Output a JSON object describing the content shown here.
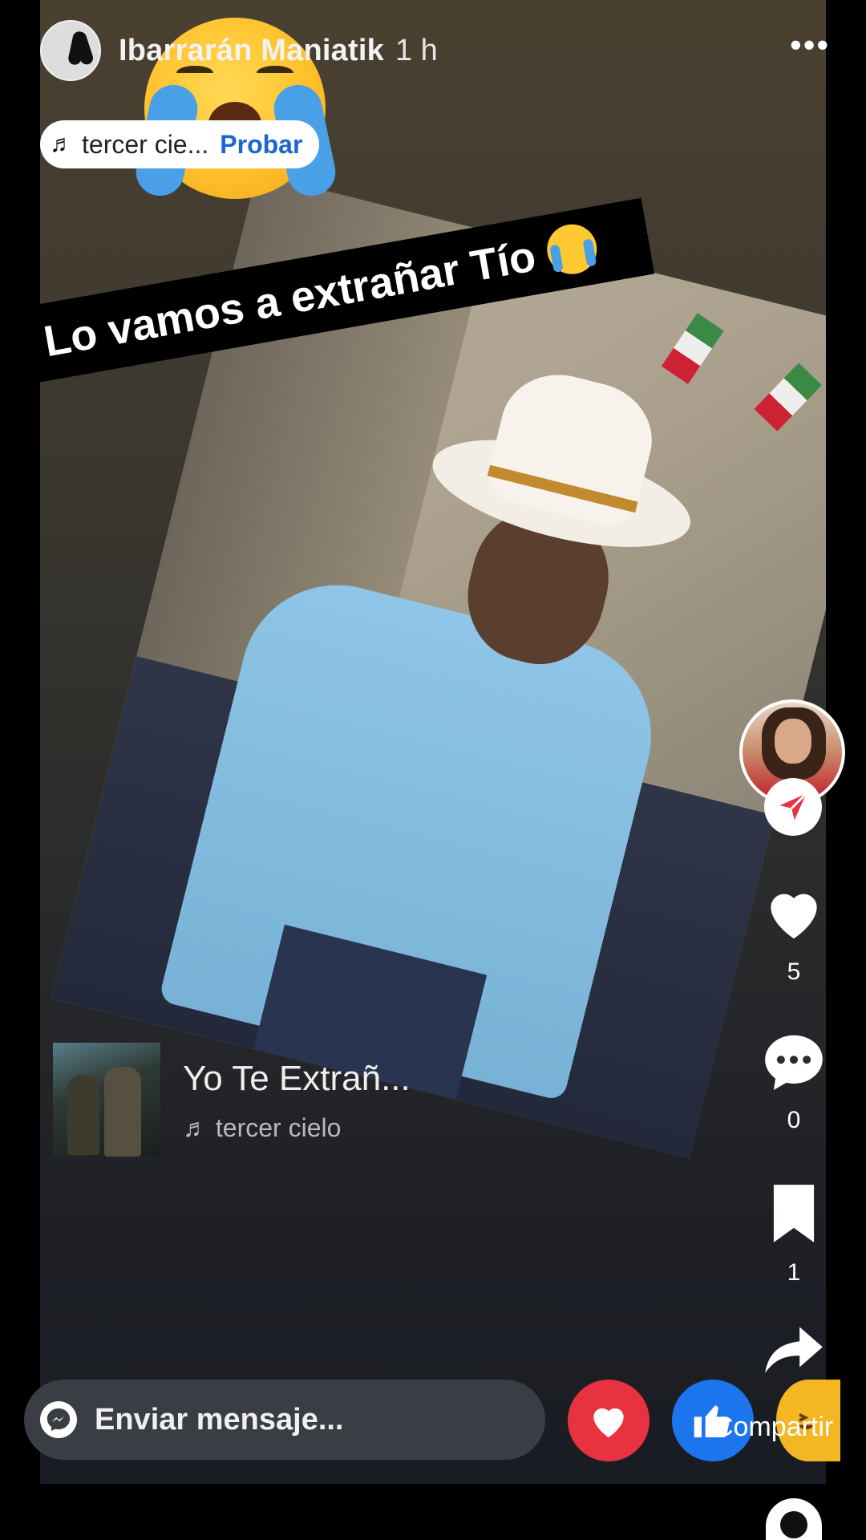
{
  "header": {
    "author_name": "Ibarrarán Maniatik",
    "time": "1 h",
    "more": "•••"
  },
  "music_chip": {
    "note": "♬",
    "track": "tercer cie...",
    "try_label": "Probar"
  },
  "caption": {
    "text": "Lo vamos a extrañar Tío"
  },
  "song": {
    "title": "Yo Te Extrañ...",
    "artist_note": "♬",
    "artist": "tercer cielo"
  },
  "rail": {
    "likes": "5",
    "comments": "0",
    "saves": "1",
    "share_label": "Compartir"
  },
  "message_bar": {
    "placeholder": "Enviar mensaje..."
  },
  "colors": {
    "accent_blue": "#1b66d2",
    "love_red": "#e8323f",
    "like_blue": "#1d75ee",
    "send_red": "#e8323f"
  }
}
